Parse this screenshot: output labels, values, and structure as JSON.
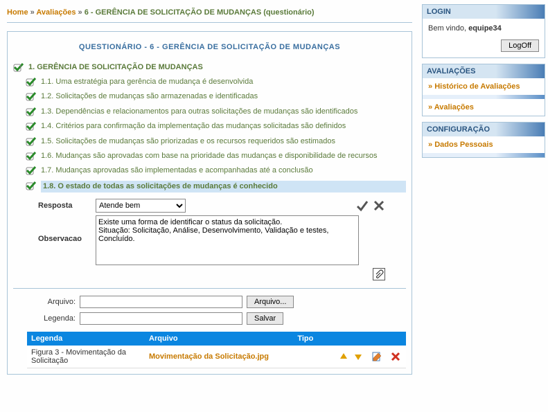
{
  "breadcrumb": {
    "home": "Home",
    "avaliacoes": "Avaliações",
    "current": "6 - GERÊNCIA DE SOLICITAÇÃO DE MUDANÇAS (questionário)"
  },
  "panel": {
    "title": "QUESTIONÁRIO - 6 - GERÊNCIA DE SOLICITAÇÃO DE MUDANÇAS",
    "section": "1. GERÊNCIA DE SOLICITAÇÃO DE MUDANÇAS",
    "items": [
      "1.1. Uma estratégia para gerência de mudança é desenvolvida",
      "1.2. Solicitações de mudanças são armazenadas e identificadas",
      "1.3. Dependências e relacionamentos para outras solicitações de mudanças são identificados",
      "1.4. Critérios para confirmação da implementação das mudanças solicitadas são definidos",
      "1.5. Solicitações de mudanças são priorizadas e os recursos requeridos são estimados",
      "1.6. Mudanças são aprovadas com base na prioridade das mudanças e disponibilidade de recursos",
      "1.7. Mudanças aprovadas são implementadas e acompanhadas até a conclusão",
      "1.8. O estado de todas as solicitações de mudanças é conhecido"
    ]
  },
  "response": {
    "label_resposta": "Resposta",
    "select_value": "Atende bem",
    "label_observacao": "Observacao",
    "obs_value": "Existe uma forma de identificar o status da solicitação.\nSituação: Solicitação, Análise, Desenvolvimento, Validação e testes, Concluído."
  },
  "upload": {
    "label_arquivo": "Arquivo:",
    "label_legenda": "Legenda:",
    "btn_arquivo": "Arquivo...",
    "btn_salvar": "Salvar"
  },
  "file_table": {
    "headers": {
      "legenda": "Legenda",
      "arquivo": "Arquivo",
      "tipo": "Tipo"
    },
    "row": {
      "legenda": "Figura 3 - Movimentação da Solicitação",
      "arquivo": "Movimentação da Solicitação.jpg"
    }
  },
  "sidebar": {
    "login_head": "LOGIN",
    "welcome_prefix": "Bem vindo, ",
    "user": "equipe34",
    "logoff": "LogOff",
    "avaliacoes_head": "AVALIAÇÕES",
    "link_historico": "Histórico de Avaliações",
    "link_avaliacoes": "Avaliações",
    "config_head": "CONFIGURAÇÃO",
    "link_dados": "Dados Pessoais"
  }
}
